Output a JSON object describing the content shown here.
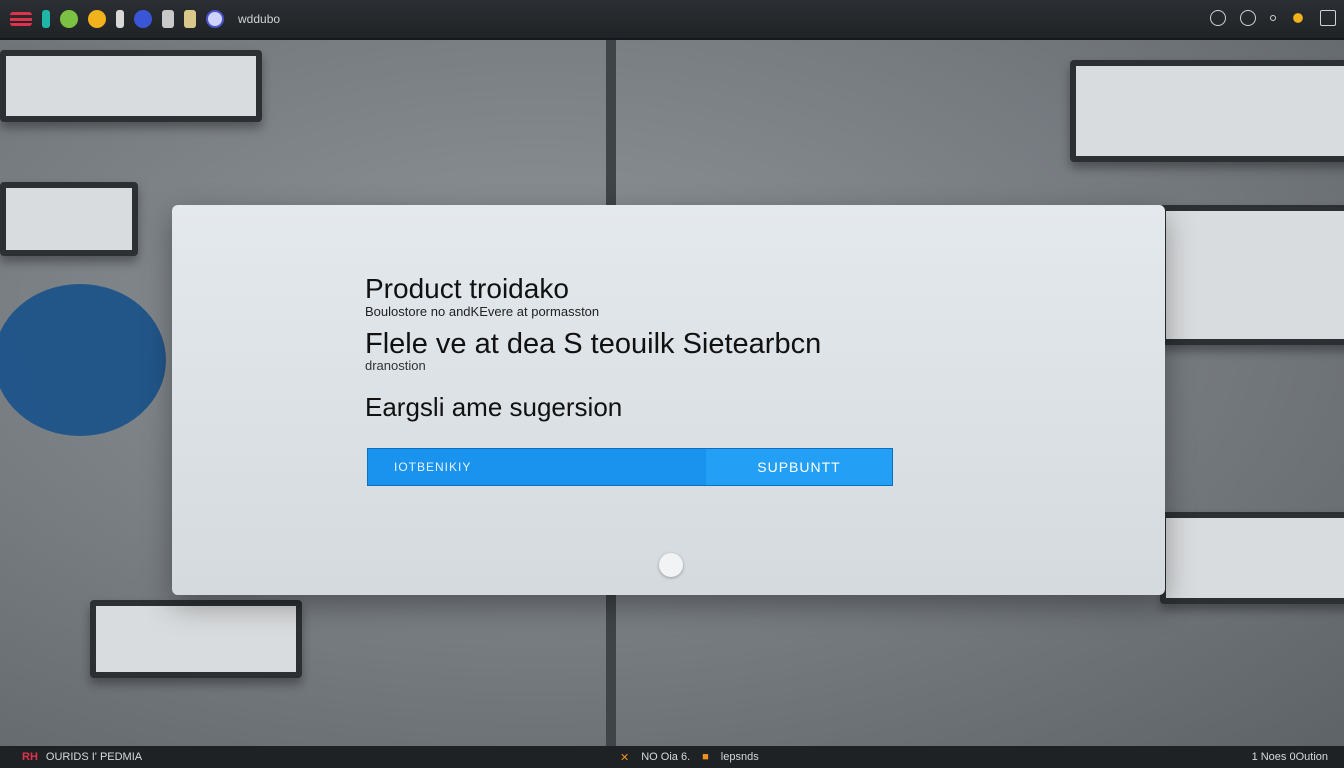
{
  "topbar": {
    "app_label": "wddubo",
    "icons": [
      "menu-icon",
      "app-icon-teal",
      "app-icon-green",
      "app-icon-yellow",
      "app-icon-file",
      "app-icon-blue",
      "app-icon-doc",
      "app-icon-folder",
      "globe-icon"
    ],
    "right_icons": [
      "moon-icon",
      "globe-icon",
      "dot-icon",
      "sun-icon",
      "exit-icon"
    ]
  },
  "dialog": {
    "title": "Product troidako",
    "subtitle": "Boulostore no andKEvere at pormasston",
    "line1": "Flele ve at dea S teouilk Sietearbcn",
    "hint": "dranostion",
    "line2": "Eargsli ame sugersion",
    "input_placeholder": "IOTBENIKIY",
    "submit_label": "SUPBUNTT"
  },
  "bottombar": {
    "tag": "RH",
    "left_text": "OURIDS I'  PEDMIA",
    "mid_text": "NO Oia 6.",
    "mid_text2": "lepsnds",
    "right_text": "1 Noes 0Oution"
  },
  "colors": {
    "accent": "#1a93ef",
    "topbar_bg": "#2b2f33",
    "dialog_bg": "#e4e9ed",
    "brand_red": "#e0324a"
  }
}
